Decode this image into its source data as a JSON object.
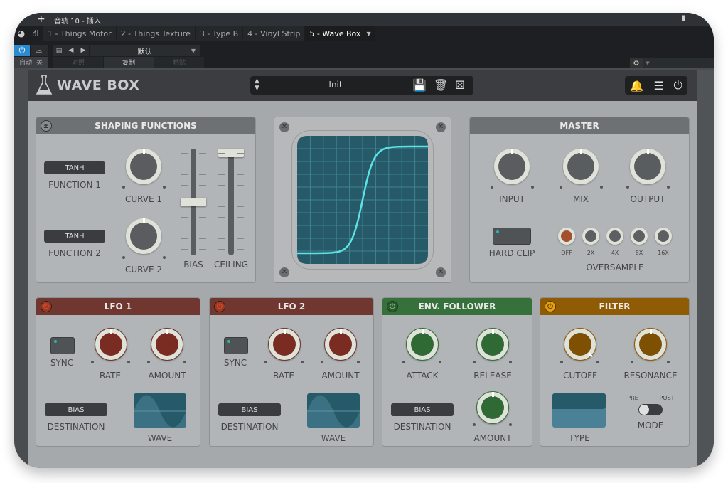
{
  "titlebar": {
    "title": "音轨 10 - 插入",
    "plus_icon": "plus-icon",
    "pin_icon": "pin-icon"
  },
  "tabs": [
    {
      "label": "1 - Things Motor",
      "active": false
    },
    {
      "label": "2 - Things Texture",
      "active": false
    },
    {
      "label": "3 - Type B",
      "active": false
    },
    {
      "label": "4 - Vinyl Strip",
      "active": false
    },
    {
      "label": "5 - Wave Box",
      "active": true
    }
  ],
  "controls": {
    "auto_label": "自动: 关",
    "preset_name": "默认",
    "compare_label": "对照",
    "copy_label": "复制",
    "paste_label": "粘贴"
  },
  "plugin": {
    "brand": "WAVE BOX",
    "preset": "Init",
    "shaping": {
      "title": "SHAPING FUNCTIONS",
      "function1_value": "TANH",
      "function1_label": "FUNCTION 1",
      "function2_value": "TANH",
      "function2_label": "FUNCTION 2",
      "curve1_label": "CURVE 1",
      "curve2_label": "CURVE 2",
      "bias_label": "BIAS",
      "ceiling_label": "CEILING",
      "bias_value": 0.5,
      "ceiling_value": 1.0
    },
    "scope": {
      "curve": "tanh",
      "color": "#5ce3e6"
    },
    "master": {
      "title": "MASTER",
      "input_label": "INPUT",
      "mix_label": "MIX",
      "output_label": "OUTPUT",
      "hardclip_label": "HARD CLIP",
      "oversample_label": "OVERSAMPLE",
      "oversample_options": [
        "OFF",
        "2X",
        "4X",
        "8X",
        "16X"
      ],
      "oversample_selected": "OFF"
    },
    "lfo1": {
      "title": "LFO 1",
      "sync_label": "SYNC",
      "rate_label": "RATE",
      "amount_label": "AMOUNT",
      "destination_value": "BIAS",
      "destination_label": "DESTINATION",
      "wave_label": "WAVE",
      "color": "#6f372f"
    },
    "lfo2": {
      "title": "LFO 2",
      "sync_label": "SYNC",
      "rate_label": "RATE",
      "amount_label": "AMOUNT",
      "destination_value": "BIAS",
      "destination_label": "DESTINATION",
      "wave_label": "WAVE",
      "color": "#6f372f"
    },
    "env": {
      "title": "ENV. FOLLOWER",
      "attack_label": "ATTACK",
      "release_label": "RELEASE",
      "amount_label": "AMOUNT",
      "destination_value": "BIAS",
      "destination_label": "DESTINATION",
      "color": "#36703a"
    },
    "filter": {
      "title": "FILTER",
      "cutoff_label": "CUTOFF",
      "resonance_label": "RESONANCE",
      "type_label": "TYPE",
      "pre_label": "PRE",
      "post_label": "POST",
      "mode_label": "MODE",
      "mode_value": "PRE",
      "color": "#8f5c05"
    }
  }
}
